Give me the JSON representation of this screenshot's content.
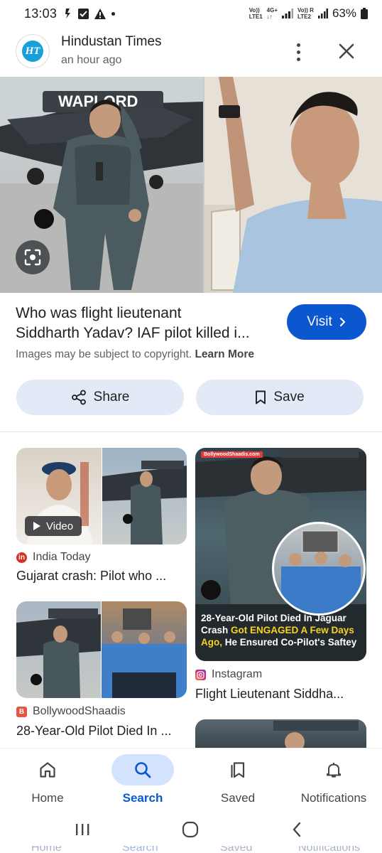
{
  "status_bar": {
    "time": "13:03",
    "network_top": "Vo)) 4G+",
    "lte1": "LTE1",
    "lte2": "LTE2",
    "battery": "63%"
  },
  "header": {
    "source_name": "Hindustan Times",
    "logo_text": "HT",
    "time_ago": "an hour ago"
  },
  "hero": {
    "banner_text": "WAPLORD"
  },
  "result": {
    "title_line1": "Who was flight lieutenant",
    "title_line2": "Siddharth Yadav? IAF pilot killed i...",
    "visit_label": "Visit",
    "copyright_text": "Images may be subject to copyright.",
    "learn_more": "Learn More",
    "share_label": "Share",
    "save_label": "Save"
  },
  "related": [
    {
      "source": "India Today",
      "source_icon": "in",
      "source_color": "#d93025",
      "title": "Gujarat crash: Pilot who ...",
      "chip": "Video"
    },
    {
      "source": "Instagram",
      "source_icon": "ig",
      "source_color": "#c13584",
      "title": "Flight Lieutenant Siddha...",
      "watermark": "BollywoodShaadis.com",
      "overlay_line1": "28-Year-Old Pilot Died In Jaguar",
      "overlay_line2a": "Crash ",
      "overlay_line2b": "Got ENGAGED A Few Days",
      "overlay_line3a": "Ago,",
      "overlay_line3b": " He Ensured Co-Pilot's Saftey"
    },
    {
      "source": "BollywoodShaadis",
      "source_icon": "B",
      "source_color": "#e8553f",
      "title": "28-Year-Old Pilot Died In ..."
    }
  ],
  "bottom_nav": {
    "items": [
      {
        "label": "Home",
        "icon": "home-icon"
      },
      {
        "label": "Search",
        "icon": "search-icon",
        "active": true
      },
      {
        "label": "Saved",
        "icon": "saved-icon"
      },
      {
        "label": "Notifications",
        "icon": "bell-icon"
      }
    ]
  },
  "colors": {
    "accent": "#0b57d0",
    "chip_bg": "#e3eaf7",
    "active_nav_bg": "#d3e3fd"
  }
}
